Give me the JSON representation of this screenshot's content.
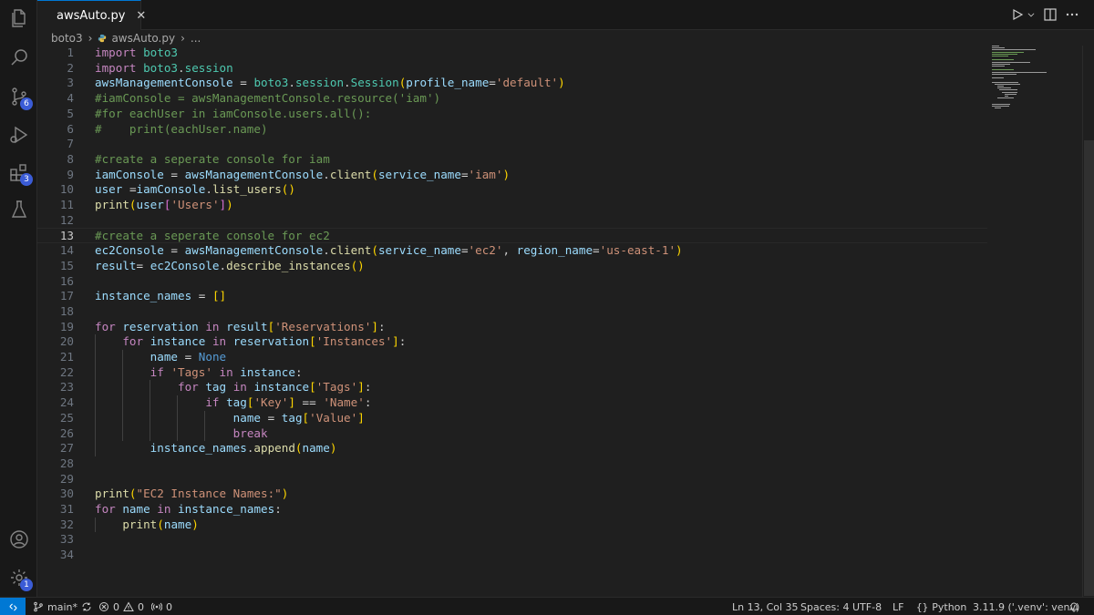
{
  "tab": {
    "filename": "awsAuto.py",
    "close": "✕"
  },
  "breadcrumb": {
    "folder": "boto3",
    "file": "awsAuto.py",
    "more": "..."
  },
  "activity_bar": {
    "icons": [
      "explorer-icon",
      "search-icon",
      "source-control-icon",
      "run-debug-icon",
      "extensions-icon",
      "testing-icon",
      "account-icon",
      "manage-gear-icon"
    ],
    "source_control_badge": "6",
    "extensions_badge": "3",
    "manage_badge": "1"
  },
  "editor": {
    "active_line": 13,
    "line_numbers": [
      "1",
      "2",
      "3",
      "4",
      "5",
      "6",
      "7",
      "8",
      "9",
      "10",
      "11",
      "12",
      "13",
      "14",
      "15",
      "16",
      "17",
      "18",
      "19",
      "20",
      "21",
      "22",
      "23",
      "24",
      "25",
      "26",
      "27",
      "28",
      "29",
      "30",
      "31",
      "32",
      "33",
      "34"
    ]
  },
  "statusbar": {
    "branch": "main*",
    "errors": "0",
    "warnings": "0",
    "ports": "0",
    "position": "Ln 13, Col 35",
    "spaces": "Spaces: 4",
    "encoding": "UTF-8",
    "eol": "LF",
    "language": "Python",
    "interpreter": "3.11.9 ('.venv': venv)"
  },
  "colors": {
    "accent": "#0078d4",
    "badge": "#3b5cd6",
    "keyword": "#c586c0",
    "string": "#ce9178",
    "comment": "#6a9955",
    "function": "#dcdcaa",
    "variable": "#9cdcfe",
    "class": "#4ec9b0"
  }
}
